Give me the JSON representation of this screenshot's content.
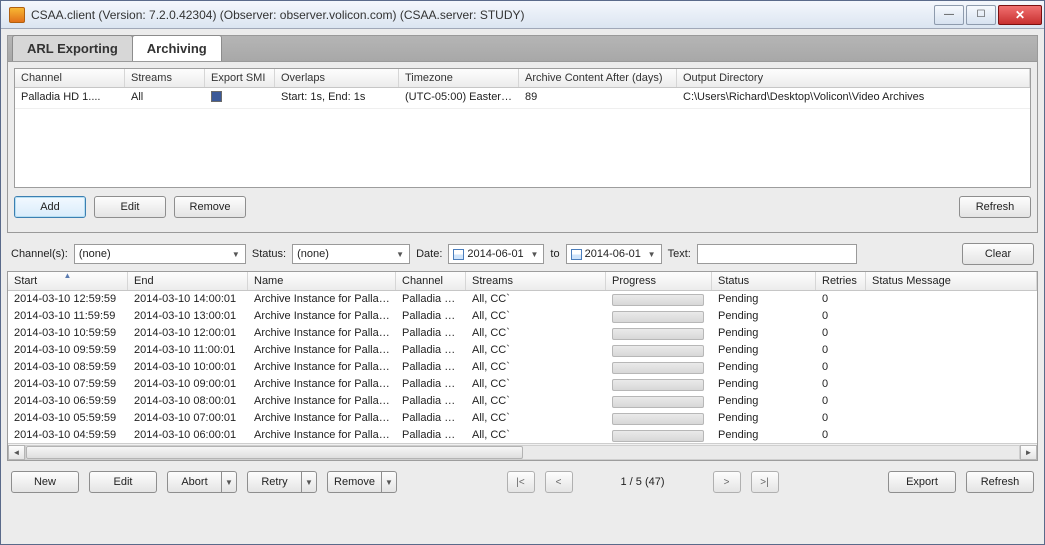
{
  "window": {
    "title": "CSAA.client (Version: 7.2.0.42304) (Observer: observer.volicon.com) (CSAA.server: STUDY)"
  },
  "tabs": {
    "left": "ARL Exporting",
    "active": "Archiving"
  },
  "upperGrid": {
    "headers": [
      "Channel",
      "Streams",
      "Export SMI",
      "Overlaps",
      "Timezone",
      "Archive Content After (days)",
      "Output Directory"
    ],
    "row": {
      "channel": "Palladia HD 1....",
      "streams": "All",
      "overlaps": "Start: 1s, End: 1s",
      "timezone": "(UTC-05:00) Eastern...",
      "after": "89",
      "output": "C:\\Users\\Richard\\Desktop\\Volicon\\Video Archives"
    }
  },
  "upperButtons": {
    "add": "Add",
    "edit": "Edit",
    "remove": "Remove",
    "refresh": "Refresh"
  },
  "filter": {
    "channelsLabel": "Channel(s):",
    "channelsValue": "(none)",
    "statusLabel": "Status:",
    "statusValue": "(none)",
    "dateLabel": "Date:",
    "dateFrom": "2014-06-01",
    "toLabel": "to",
    "dateTo": "2014-06-01",
    "textLabel": "Text:",
    "clear": "Clear"
  },
  "lowerGrid": {
    "headers": [
      "Start",
      "End",
      "Name",
      "Channel",
      "Streams",
      "Progress",
      "Status",
      "Retries",
      "Status Message"
    ],
    "rows": [
      {
        "start": "2014-03-10 12:59:59",
        "end": "2014-03-10 14:00:01",
        "name": "Archive Instance for Pallad...",
        "channel": "Palladia H...",
        "streams": "All, CC`",
        "status": "Pending",
        "retries": "0"
      },
      {
        "start": "2014-03-10 11:59:59",
        "end": "2014-03-10 13:00:01",
        "name": "Archive Instance for Pallad...",
        "channel": "Palladia H...",
        "streams": "All, CC`",
        "status": "Pending",
        "retries": "0"
      },
      {
        "start": "2014-03-10 10:59:59",
        "end": "2014-03-10 12:00:01",
        "name": "Archive Instance for Pallad...",
        "channel": "Palladia H...",
        "streams": "All, CC`",
        "status": "Pending",
        "retries": "0"
      },
      {
        "start": "2014-03-10 09:59:59",
        "end": "2014-03-10 11:00:01",
        "name": "Archive Instance for Pallad...",
        "channel": "Palladia H...",
        "streams": "All, CC`",
        "status": "Pending",
        "retries": "0"
      },
      {
        "start": "2014-03-10 08:59:59",
        "end": "2014-03-10 10:00:01",
        "name": "Archive Instance for Pallad...",
        "channel": "Palladia H...",
        "streams": "All, CC`",
        "status": "Pending",
        "retries": "0"
      },
      {
        "start": "2014-03-10 07:59:59",
        "end": "2014-03-10 09:00:01",
        "name": "Archive Instance for Pallad...",
        "channel": "Palladia H...",
        "streams": "All, CC`",
        "status": "Pending",
        "retries": "0"
      },
      {
        "start": "2014-03-10 06:59:59",
        "end": "2014-03-10 08:00:01",
        "name": "Archive Instance for Pallad...",
        "channel": "Palladia H...",
        "streams": "All, CC`",
        "status": "Pending",
        "retries": "0"
      },
      {
        "start": "2014-03-10 05:59:59",
        "end": "2014-03-10 07:00:01",
        "name": "Archive Instance for Pallad...",
        "channel": "Palladia H...",
        "streams": "All, CC`",
        "status": "Pending",
        "retries": "0"
      },
      {
        "start": "2014-03-10 04:59:59",
        "end": "2014-03-10 06:00:01",
        "name": "Archive Instance for Pallad...",
        "channel": "Palladia H...",
        "streams": "All, CC`",
        "status": "Pending",
        "retries": "0"
      }
    ]
  },
  "pager": {
    "label": "1 / 5 (47)"
  },
  "bottomButtons": {
    "new": "New",
    "edit": "Edit",
    "abort": "Abort",
    "retry": "Retry",
    "remove": "Remove",
    "export": "Export",
    "refresh": "Refresh"
  }
}
